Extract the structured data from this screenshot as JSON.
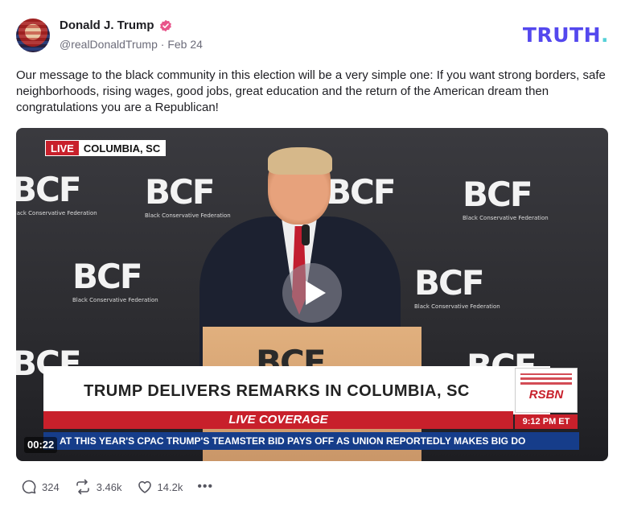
{
  "author": {
    "display_name": "Donald J. Trump",
    "handle": "@realDonaldTrump",
    "separator": "·",
    "date": "Feb 24",
    "verified_icon": "verified-badge-icon",
    "verified_color": "#e8548a"
  },
  "brand": {
    "logo_text": "TRUTH",
    "logo_dot": ".",
    "logo_color": "#5448ee",
    "dot_color": "#56d1d8"
  },
  "post": {
    "text": "Our message to the black community in this election will be a very simple one: If you want strong borders, safe neighborhoods, rising wages, good jobs, great education and the return of the American dream then congratulations you are a Republican!"
  },
  "video": {
    "live_badge": "LIVE",
    "location": "COLUMBIA, SC",
    "backdrop_logo": "BCF",
    "backdrop_subtitle": "Black Conservative Federation",
    "headline": "TRUMP DELIVERS REMARKS IN COLUMBIA, SC",
    "coverage": "LIVE COVERAGE",
    "network": "RSBN",
    "broadcast_time": "9:12 PM ET",
    "ticker": "AT THIS YEAR'S CPAC    TRUMP'S TEAMSTER BID PAYS OFF AS UNION REPORTEDLY MAKES BIG DO",
    "duration": "00:22",
    "play_icon": "play-icon"
  },
  "actions": {
    "replies": "324",
    "retruths": "3.46k",
    "likes": "14.2k",
    "more": "•••"
  }
}
